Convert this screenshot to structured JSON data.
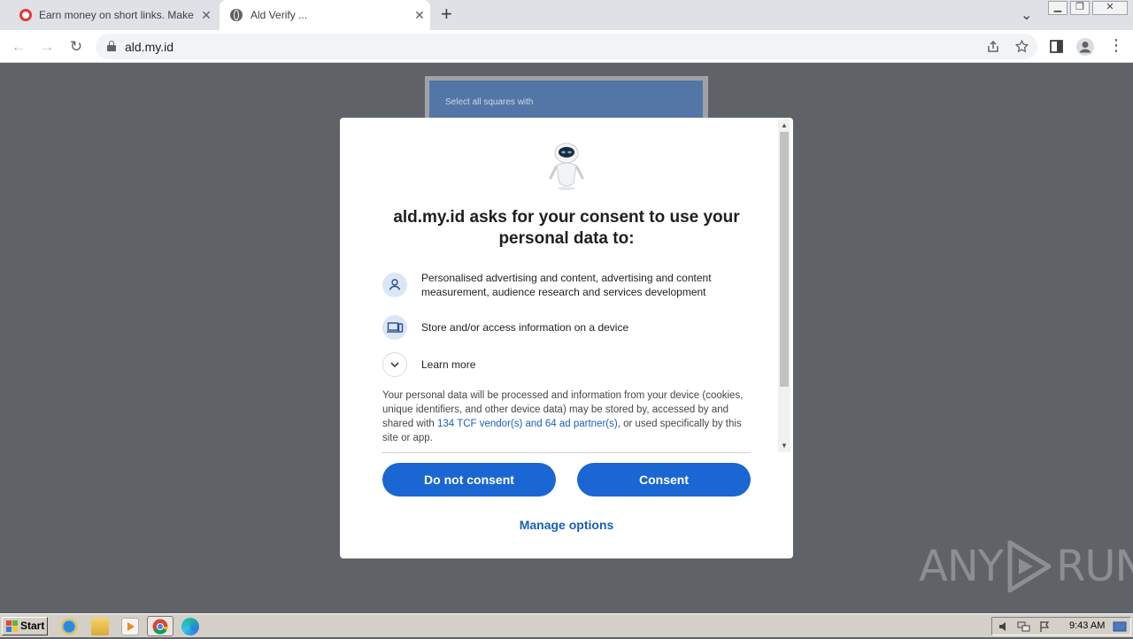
{
  "browser": {
    "tabs": [
      {
        "title": "Earn money on short links. Make sho",
        "active": false
      },
      {
        "title": "Ald Verify ...",
        "active": true
      }
    ],
    "new_tab": "+",
    "close": "✕",
    "tab_search": "⌄",
    "url": "ald.my.id"
  },
  "page": {
    "captcha_prompt": "Select all squares with"
  },
  "consent": {
    "title": "ald.my.id asks for your consent to use your personal data to:",
    "purposes": [
      {
        "icon": "person-icon",
        "text": "Personalised advertising and content, advertising and content measurement, audience research and services development"
      },
      {
        "icon": "device-icon",
        "text": "Store and/or access information on a device"
      }
    ],
    "learn_more": "Learn more",
    "body_before": "Your personal data will be processed and information from your device (cookies, unique identifiers, and other device data) may be stored by, accessed by and shared with ",
    "body_link": "134 TCF vendor(s) and 64 ad partner(s)",
    "body_after": ", or used specifically by this site or app.",
    "do_not_consent": "Do not consent",
    "consent": "Consent",
    "manage_options": "Manage options"
  },
  "watermark": {
    "left": "ANY",
    "right": "RUN"
  },
  "taskbar": {
    "start": "Start",
    "clock": "9:43 AM"
  },
  "colors": {
    "primary_button": "#1a66d2",
    "link": "#1a5fc1",
    "overlay": "#5f6368"
  }
}
